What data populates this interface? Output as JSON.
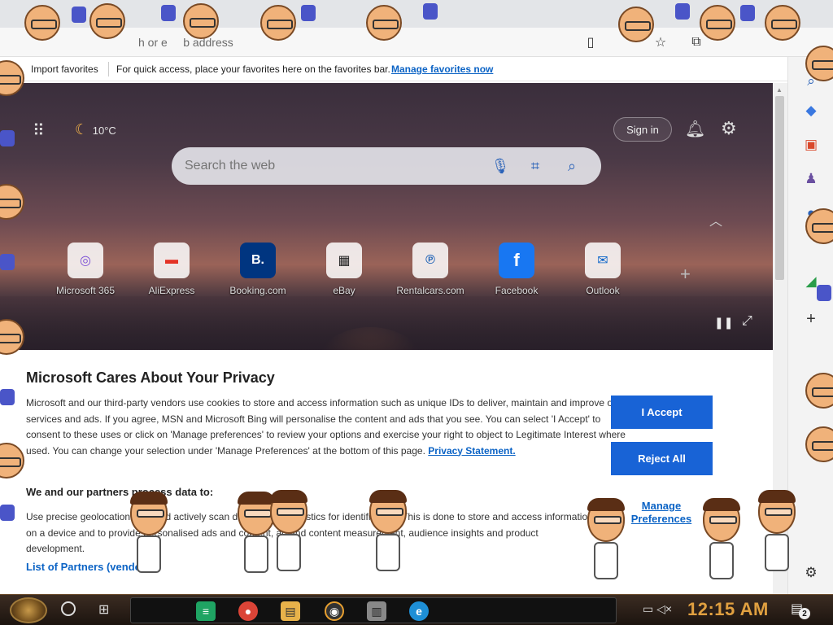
{
  "browser": {
    "address_placeholder": "Search or enter web address",
    "address_visible_text": "h or e     b address"
  },
  "favorites_bar": {
    "import_label": "Import favorites",
    "hint": "For quick access, place your favorites here on the favorites bar.",
    "manage_link": "Manage favorites now"
  },
  "ntp": {
    "weather_temp": "10°C",
    "signin_label": "Sign in",
    "search_placeholder": "Search the web",
    "tiles": [
      {
        "label": "Microsoft 365",
        "glyph": "◎",
        "color": "#7b4fd6"
      },
      {
        "label": "AliExpress",
        "glyph": "▬",
        "color": "#e43225"
      },
      {
        "label": "Booking.com",
        "glyph": "B.",
        "color": "#003580"
      },
      {
        "label": "eBay",
        "glyph": "▦",
        "color": "#222222"
      },
      {
        "label": "Rentalcars.com",
        "glyph": "℗",
        "color": "#1a5fb4"
      },
      {
        "label": "Facebook",
        "glyph": "f",
        "color": "#1877f2"
      },
      {
        "label": "Outlook",
        "glyph": "✉",
        "color": "#0a64c9"
      }
    ]
  },
  "privacy": {
    "title": "Microsoft Cares About Your Privacy",
    "body_p1": "Microsoft and our third-party vendors use cookies to store and access information such as unique IDs to deliver, maintain and improve our services and ads. If you agree, MSN and Microsoft Bing will personalise the content and ads that you see. You can select 'I Accept' to consent to these uses or click on 'Manage preferences' to review your options and exercise your right to object to Legitimate Interest where used.  You can change your selection under 'Manage Preferences' at the bottom of this page.",
    "privacy_link": "Privacy Statement.",
    "subheading": "We and our partners process data to:",
    "body_p2": "Use precise geolocation data and actively scan device characteristics for identification. This is done to store and access information on a device and to provide personalised ads and content, ad and content measurement, audience insights and product development.",
    "partners_link": "List of Partners (vendors)",
    "accept_label": "I Accept",
    "reject_label": "Reject All",
    "manage_label": "Manage Preferences"
  },
  "taskbar": {
    "time": "12:15 AM",
    "notification_count": "2"
  }
}
